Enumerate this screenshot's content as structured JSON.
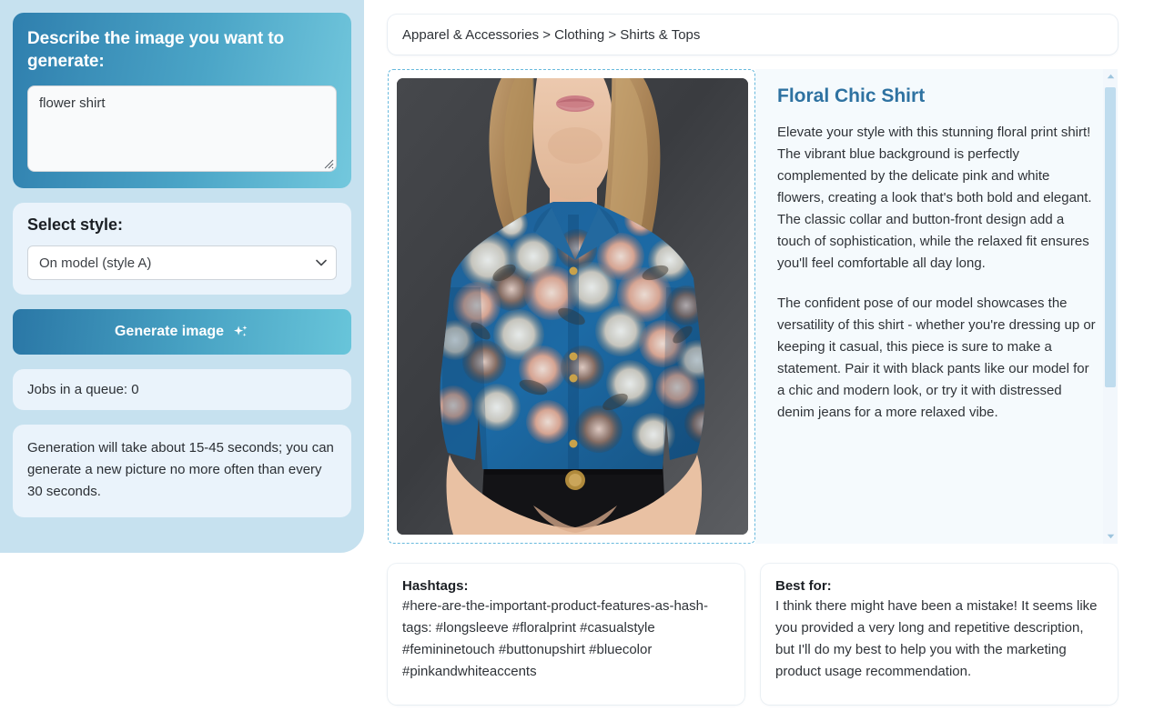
{
  "sidebar": {
    "prompt": {
      "title": "Describe the image you want to generate:",
      "value": "flower shirt",
      "placeholder": ""
    },
    "style": {
      "title": "Select style:",
      "selected": "On model (style A)",
      "options": [
        "On model (style A)"
      ]
    },
    "generate_button": {
      "label": "Generate image",
      "icon": "sparkle-icon"
    },
    "queue": {
      "text": "Jobs in a queue: 0"
    },
    "info": {
      "text": "Generation will take about 15-45 seconds; you can generate a new picture no more often than every 30 seconds."
    }
  },
  "main": {
    "breadcrumb": "Apparel & Accessories > Clothing > Shirts & Tops",
    "product": {
      "title": "Floral Chic Shirt",
      "paragraphs": [
        "Elevate your style with this stunning floral print shirt! The vibrant blue background is perfectly complemented by the delicate pink and white flowers, creating a look that's both bold and elegant. The classic collar and button-front design add a touch of sophistication, while the relaxed fit ensures you'll feel comfortable all day long.",
        "The confident pose of our model showcases the versatility of this shirt - whether you're dressing up or keeping it casual, this piece is sure to make a statement. Pair it with black pants like our model for a chic and modern look, or try it with distressed denim jeans for a more relaxed vibe."
      ]
    },
    "image": {
      "alt": "Model wearing blue floral print button-up shirt"
    },
    "hashtags": {
      "label": "Hashtags:",
      "text": "#here-are-the-important-product-features-as-hash-tags: #longsleeve #floralprint #casualstyle #femininetouch #buttonupshirt #bluecolor #pinkandwhiteaccents"
    },
    "best_for": {
      "label": "Best for:",
      "text": "I think there might have been a mistake! It seems like you provided a very long and repetitive description, but I'll do my best to help you with the marketing product usage recommendation."
    }
  },
  "colors": {
    "sidebar_bg": "#c6e1ef",
    "prompt_gradient_start": "#2f7fae",
    "prompt_gradient_end": "#73c8dd",
    "panel_bg": "#eaf3fb",
    "accent_title": "#2e72a1",
    "dashed_border": "#68b9dd",
    "scrollbar_thumb": "#bfdcee"
  }
}
